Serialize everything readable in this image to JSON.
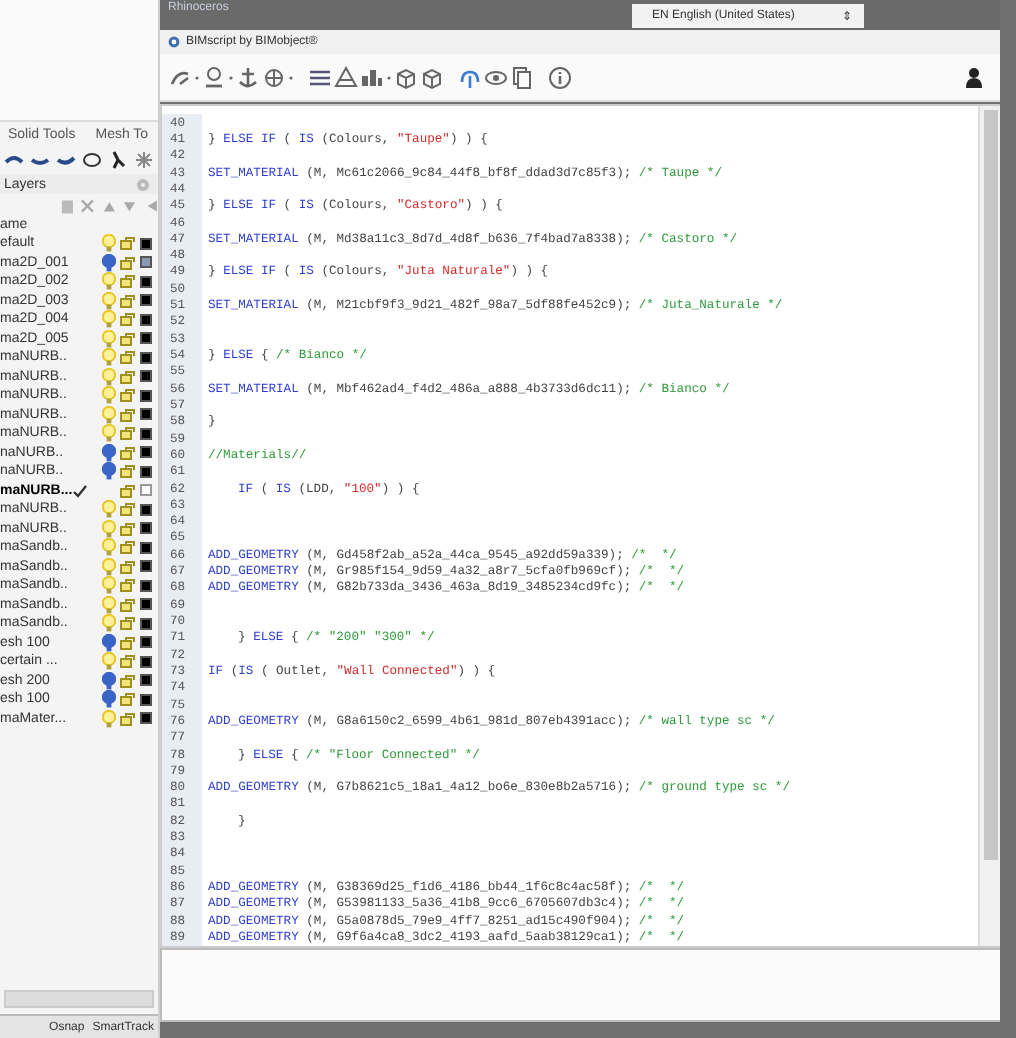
{
  "app": {
    "title": "Rhinoceros"
  },
  "toolbar_tabs": [
    "Solid Tools",
    "Mesh To"
  ],
  "layers": {
    "title": "Layers",
    "column": "ame",
    "items": [
      {
        "name": "efault",
        "visible": true,
        "current": false,
        "color": "#000000"
      },
      {
        "name": "ma2D_001",
        "visible": false,
        "current": false,
        "color": "#8a9bb0"
      },
      {
        "name": "ma2D_002",
        "visible": true,
        "current": false,
        "color": "#000000"
      },
      {
        "name": "ma2D_003",
        "visible": true,
        "current": false,
        "color": "#000000"
      },
      {
        "name": "ma2D_004",
        "visible": true,
        "current": false,
        "color": "#000000"
      },
      {
        "name": "ma2D_005",
        "visible": true,
        "current": false,
        "color": "#000000"
      },
      {
        "name": "maNURB..",
        "visible": true,
        "current": false,
        "color": "#000000"
      },
      {
        "name": "maNURB..",
        "visible": true,
        "current": false,
        "color": "#000000"
      },
      {
        "name": "maNURB..",
        "visible": true,
        "current": false,
        "color": "#000000"
      },
      {
        "name": "maNURB..",
        "visible": true,
        "current": false,
        "color": "#000000"
      },
      {
        "name": "maNURB..",
        "visible": true,
        "current": false,
        "color": "#000000"
      },
      {
        "name": "naNURB..",
        "visible": false,
        "current": false,
        "color": "#000000"
      },
      {
        "name": "naNURB..",
        "visible": false,
        "current": false,
        "color": "#000000"
      },
      {
        "name": "maNURB...",
        "current": true,
        "color": "#ffffff"
      },
      {
        "name": "maNURB..",
        "visible": true,
        "current": false,
        "color": "#000000"
      },
      {
        "name": "maNURB..",
        "visible": true,
        "current": false,
        "color": "#000000"
      },
      {
        "name": "maSandb..",
        "visible": true,
        "current": false,
        "color": "#000000"
      },
      {
        "name": "maSandb..",
        "visible": true,
        "current": false,
        "color": "#000000"
      },
      {
        "name": "maSandb..",
        "visible": true,
        "current": false,
        "color": "#000000"
      },
      {
        "name": "maSandb..",
        "visible": true,
        "current": false,
        "color": "#000000"
      },
      {
        "name": "maSandb..",
        "visible": true,
        "current": false,
        "color": "#000000"
      },
      {
        "name": "esh 100",
        "visible": false,
        "current": false,
        "color": "#000000"
      },
      {
        "name": "certain ...",
        "visible": true,
        "current": false,
        "color": "#000000"
      },
      {
        "name": "esh 200",
        "visible": false,
        "current": false,
        "color": "#000000"
      },
      {
        "name": "esh 100",
        "visible": false,
        "current": false,
        "color": "#000000"
      },
      {
        "name": "maMater...",
        "visible": true,
        "current": false,
        "color": "#000000"
      }
    ]
  },
  "status_bar": [
    "Osnap",
    "SmartTrack"
  ],
  "language": {
    "value": "EN English (United States)",
    "arrow": "⇕"
  },
  "plugin": {
    "title": "BIMscript by BIMobject®"
  },
  "editor": {
    "lines": [
      {
        "number": "40"
      },
      {
        "number": "41",
        "tokens": [
          {
            "kind": "text",
            "text": "} "
          },
          {
            "kind": "kw",
            "text": "ELSE IF"
          },
          {
            "kind": "text",
            "text": " ( "
          },
          {
            "kind": "kw",
            "text": "IS"
          },
          {
            "kind": "text",
            "text": " (Colours, "
          },
          {
            "kind": "str",
            "text": "\"Taupe\""
          },
          {
            "kind": "text",
            "text": ") ) {"
          }
        ]
      },
      {
        "number": "42"
      },
      {
        "number": "43",
        "tokens": [
          {
            "kind": "kw",
            "text": "SET_MATERIAL"
          },
          {
            "kind": "text",
            "text": " (M, Mc61c2066_9c84_44f8_bf8f_ddad3d7c85f3); "
          },
          {
            "kind": "com",
            "text": "/* Taupe */"
          }
        ]
      },
      {
        "number": "44"
      },
      {
        "number": "45",
        "tokens": [
          {
            "kind": "text",
            "text": "} "
          },
          {
            "kind": "kw",
            "text": "ELSE IF"
          },
          {
            "kind": "text",
            "text": " ( "
          },
          {
            "kind": "kw",
            "text": "IS"
          },
          {
            "kind": "text",
            "text": " (Colours, "
          },
          {
            "kind": "str",
            "text": "\"Castoro\""
          },
          {
            "kind": "text",
            "text": ") ) {"
          }
        ]
      },
      {
        "number": "46"
      },
      {
        "number": "47",
        "tokens": [
          {
            "kind": "kw",
            "text": "SET_MATERIAL"
          },
          {
            "kind": "text",
            "text": " (M, Md38a11c3_8d7d_4d8f_b636_7f4bad7a8338); "
          },
          {
            "kind": "com",
            "text": "/* Castoro */"
          }
        ]
      },
      {
        "number": "48"
      },
      {
        "number": "49",
        "tokens": [
          {
            "kind": "text",
            "text": "} "
          },
          {
            "kind": "kw",
            "text": "ELSE IF"
          },
          {
            "kind": "text",
            "text": " ( "
          },
          {
            "kind": "kw",
            "text": "IS"
          },
          {
            "kind": "text",
            "text": " (Colours, "
          },
          {
            "kind": "str",
            "text": "\"Juta Naturale\""
          },
          {
            "kind": "text",
            "text": ") ) {"
          }
        ]
      },
      {
        "number": "50"
      },
      {
        "number": "51",
        "tokens": [
          {
            "kind": "kw",
            "text": "SET_MATERIAL"
          },
          {
            "kind": "text",
            "text": " (M, M21cbf9f3_9d21_482f_98a7_5df88fe452c9); "
          },
          {
            "kind": "com",
            "text": "/* Juta_Naturale */"
          }
        ]
      },
      {
        "number": "52"
      },
      {
        "number": "53"
      },
      {
        "number": "54",
        "tokens": [
          {
            "kind": "text",
            "text": "} "
          },
          {
            "kind": "kw",
            "text": "ELSE"
          },
          {
            "kind": "text",
            "text": " { "
          },
          {
            "kind": "com",
            "text": "/* Bianco */"
          }
        ]
      },
      {
        "number": "55"
      },
      {
        "number": "56",
        "tokens": [
          {
            "kind": "kw",
            "text": "SET_MATERIAL"
          },
          {
            "kind": "text",
            "text": " (M, Mbf462ad4_f4d2_486a_a888_4b3733d6dc11); "
          },
          {
            "kind": "com",
            "text": "/* Bianco */"
          }
        ]
      },
      {
        "number": "57"
      },
      {
        "number": "58",
        "tokens": [
          {
            "kind": "text",
            "text": "}"
          }
        ]
      },
      {
        "number": "59"
      },
      {
        "number": "60",
        "tokens": [
          {
            "kind": "com",
            "text": "//Materials//"
          }
        ]
      },
      {
        "number": "61"
      },
      {
        "number": "62",
        "indent": true,
        "tokens": [
          {
            "kind": "kw",
            "text": "IF"
          },
          {
            "kind": "text",
            "text": " ( "
          },
          {
            "kind": "kw",
            "text": "IS"
          },
          {
            "kind": "text",
            "text": " (LDD, "
          },
          {
            "kind": "str",
            "text": "\"100\""
          },
          {
            "kind": "text",
            "text": ") ) {"
          }
        ]
      },
      {
        "number": "63"
      },
      {
        "number": "64"
      },
      {
        "number": "65"
      },
      {
        "number": "66",
        "tokens": [
          {
            "kind": "kw",
            "text": "ADD_GEOMETRY"
          },
          {
            "kind": "text",
            "text": " (M, Gd458f2ab_a52a_44ca_9545_a92dd59a339); "
          },
          {
            "kind": "com",
            "text": "/*  */"
          }
        ]
      },
      {
        "number": "67",
        "tokens": [
          {
            "kind": "kw",
            "text": "ADD_GEOMETRY"
          },
          {
            "kind": "text",
            "text": " (M, Gr985f154_9d59_4a32_a8r7_5cfa0fb969cf); "
          },
          {
            "kind": "com",
            "text": "/*  */"
          }
        ]
      },
      {
        "number": "68",
        "tokens": [
          {
            "kind": "kw",
            "text": "ADD_GEOMETRY"
          },
          {
            "kind": "text",
            "text": " (M, G82b733da_3436_463a_8d19_3485234cd9fc); "
          },
          {
            "kind": "com",
            "text": "/*  */"
          }
        ]
      },
      {
        "number": "69"
      },
      {
        "number": "70"
      },
      {
        "number": "71",
        "indent": true,
        "tokens": [
          {
            "kind": "text",
            "text": "} "
          },
          {
            "kind": "kw",
            "text": "ELSE"
          },
          {
            "kind": "text",
            "text": " { "
          },
          {
            "kind": "com",
            "text": "/* \"200\" \"300\" */"
          }
        ]
      },
      {
        "number": "72"
      },
      {
        "number": "73",
        "tokens": [
          {
            "kind": "kw",
            "text": "IF"
          },
          {
            "kind": "text",
            "text": " ("
          },
          {
            "kind": "kw",
            "text": "IS"
          },
          {
            "kind": "text",
            "text": " ( Outlet, "
          },
          {
            "kind": "str",
            "text": "\"Wall Connected\""
          },
          {
            "kind": "text",
            "text": ") ) {"
          }
        ]
      },
      {
        "number": "74"
      },
      {
        "number": "75"
      },
      {
        "number": "76",
        "tokens": [
          {
            "kind": "kw",
            "text": "ADD_GEOMETRY"
          },
          {
            "kind": "text",
            "text": " (M, G8a6150c2_6599_4b61_981d_807eb4391acc); "
          },
          {
            "kind": "com",
            "text": "/* wall type sc */"
          }
        ]
      },
      {
        "number": "77"
      },
      {
        "number": "78",
        "indent": true,
        "tokens": [
          {
            "kind": "text",
            "text": "} "
          },
          {
            "kind": "kw",
            "text": "ELSE"
          },
          {
            "kind": "text",
            "text": " { "
          },
          {
            "kind": "com",
            "text": "/* \"Floor Connected\" */"
          }
        ]
      },
      {
        "number": "79"
      },
      {
        "number": "80",
        "tokens": [
          {
            "kind": "kw",
            "text": "ADD_GEOMETRY"
          },
          {
            "kind": "text",
            "text": " (M, G7b8621c5_18a1_4a12_bo6e_830e8b2a5716); "
          },
          {
            "kind": "com",
            "text": "/* ground type sc */"
          }
        ]
      },
      {
        "number": "81"
      },
      {
        "number": "82",
        "indent": true,
        "tokens": [
          {
            "kind": "text",
            "text": "}"
          }
        ]
      },
      {
        "number": "83"
      },
      {
        "number": "84"
      },
      {
        "number": "85"
      },
      {
        "number": "86",
        "tokens": [
          {
            "kind": "kw",
            "text": "ADD_GEOMETRY"
          },
          {
            "kind": "text",
            "text": " (M, G38369d25_f1d6_4186_bb44_1f6c8c4ac58f); "
          },
          {
            "kind": "com",
            "text": "/*  */"
          }
        ]
      },
      {
        "number": "87",
        "tokens": [
          {
            "kind": "kw",
            "text": "ADD_GEOMETRY"
          },
          {
            "kind": "text",
            "text": " (M, G53981133_5a36_41b8_9cc6_6705607db3c4); "
          },
          {
            "kind": "com",
            "text": "/*  */"
          }
        ]
      },
      {
        "number": "88",
        "tokens": [
          {
            "kind": "kw",
            "text": "ADD_GEOMETRY"
          },
          {
            "kind": "text",
            "text": " (M, G5a0878d5_79e9_4ff7_8251_ad15c490f904); "
          },
          {
            "kind": "com",
            "text": "/*  */"
          }
        ]
      },
      {
        "number": "89",
        "tokens": [
          {
            "kind": "kw",
            "text": "ADD_GEOMETRY"
          },
          {
            "kind": "text",
            "text": " (M, G9f6a4ca8_3dc2_4193_aafd_5aab38129ca1); "
          },
          {
            "kind": "com",
            "text": "/*  */"
          }
        ]
      }
    ]
  }
}
